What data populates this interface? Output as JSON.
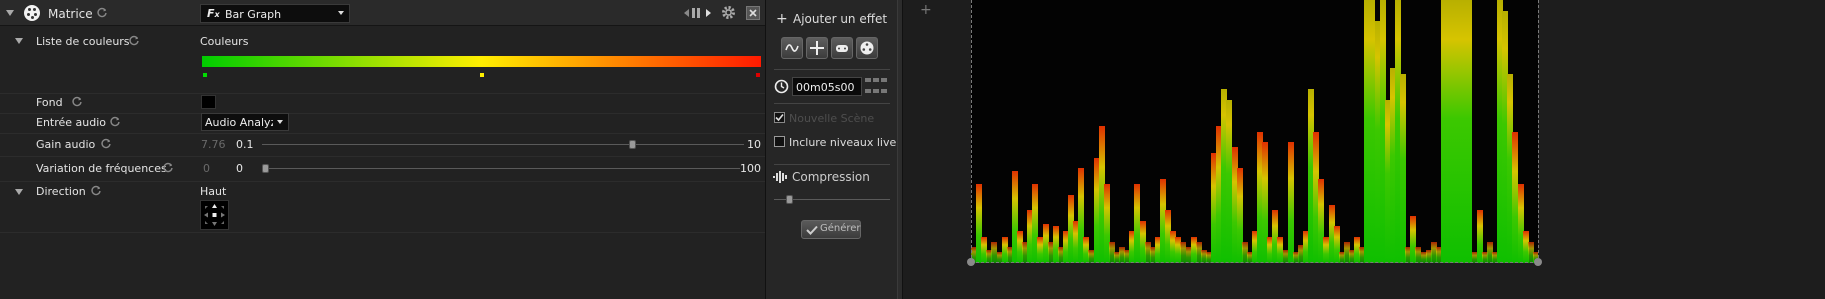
{
  "header": {
    "effect_name": "Matrice",
    "effect_type": "Bar Graph",
    "effect_type_icon": "fx-icon"
  },
  "properties": {
    "colors_label": "Liste de couleurs",
    "colors_header": "Couleurs",
    "gradient": [
      "#00cc00",
      "#ffee00",
      "#ff1a00"
    ],
    "stops": [
      {
        "pos": 0.0,
        "color": "#00dd00"
      },
      {
        "pos": 0.5,
        "color": "#ffee00"
      },
      {
        "pos": 1.0,
        "color": "#dd0000"
      }
    ],
    "background_label": "Fond",
    "background_color": "#000000",
    "audio_input_label": "Entrée audio",
    "audio_input_value": "Audio Analyzer",
    "gain_label": "Gain audio",
    "gain_current": "7.76",
    "gain_min": "0.1",
    "gain_max": "10",
    "gain_fraction": 0.77,
    "freq_label": "Variation de fréquences",
    "freq_current": "0",
    "freq_min": "0",
    "freq_max": "100",
    "freq_fraction": 0.0,
    "direction_label": "Direction",
    "direction_value": "Haut"
  },
  "effects_panel": {
    "add_effect": "Ajouter un effet",
    "duration": "00m05s00",
    "new_scene": "Nouvelle Scène",
    "new_scene_checked": true,
    "include_live": "Inclure niveaux live",
    "include_live_checked": false,
    "compression": "Compression",
    "generate": "Générer"
  },
  "preview": {
    "add_symbol": "+",
    "bar_levels": [
      0.06,
      0.3,
      0.1,
      0.05,
      0.08,
      0.04,
      0.1,
      0.06,
      0.35,
      0.12,
      0.08,
      0.2,
      0.3,
      0.1,
      0.15,
      0.08,
      0.14,
      0.06,
      0.12,
      0.26,
      0.16,
      0.36,
      0.1,
      0.05,
      0.4,
      0.52,
      0.3,
      0.08,
      0.04,
      0.06,
      0.05,
      0.12,
      0.3,
      0.16,
      0.08,
      0.06,
      0.1,
      0.32,
      0.2,
      0.12,
      0.1,
      0.08,
      0.06,
      0.1,
      0.08,
      0.05,
      0.04,
      0.42,
      0.52,
      0.66,
      0.62,
      0.44,
      0.36,
      0.08,
      0.04,
      0.12,
      0.5,
      0.46,
      0.1,
      0.2,
      0.1,
      0.05,
      0.46,
      0.04,
      0.07,
      0.12,
      0.66,
      0.5,
      0.32,
      0.1,
      0.22,
      0.14,
      0.04,
      0.08,
      0.05,
      0.1,
      0.06,
      1.0,
      1.0,
      0.92,
      1.0,
      0.62,
      0.74,
      1.0,
      0.72,
      0.06,
      0.18,
      0.06,
      0.04,
      0.05,
      0.08,
      0.06,
      1.0,
      1.0,
      1.0,
      1.0,
      1.0,
      1.0,
      0.04,
      0.2,
      0.04,
      0.08,
      0.04,
      1.0,
      0.96,
      0.72,
      0.5,
      0.3,
      0.12,
      0.08,
      0.04
    ]
  }
}
